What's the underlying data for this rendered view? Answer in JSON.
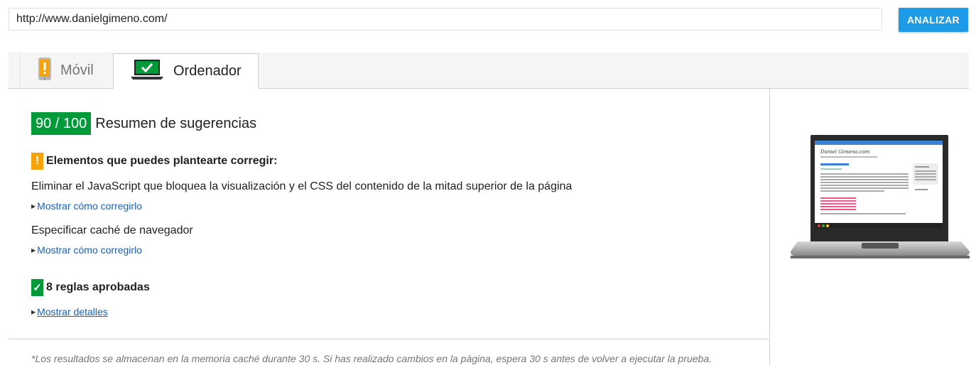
{
  "url_bar": {
    "value": "http://www.danielgimeno.com/"
  },
  "analyze_button": {
    "label": "ANALIZAR"
  },
  "tabs": [
    {
      "label": "Móvil",
      "active": false
    },
    {
      "label": "Ordenador",
      "active": true
    }
  ],
  "score": {
    "value": "90 / 100",
    "title": "Resumen de sugerencias",
    "color": "#009a3a"
  },
  "warnings": {
    "icon": "!",
    "title": "Elementos que puedes plantearte corregir:",
    "items": [
      {
        "text": "Eliminar el JavaScript que bloquea la visualización y el CSS del contenido de la mitad superior de la página",
        "link": "Mostrar cómo corregirlo"
      },
      {
        "text": "Especificar caché de navegador",
        "link": "Mostrar cómo corregirlo"
      }
    ]
  },
  "passed": {
    "icon": "✓",
    "title": "8 reglas aprobadas",
    "link": "Mostrar detalles"
  },
  "footnote": "*Los resultados se almacenan en la memoria caché durante 30 s. Si has realizado cambios en la página, espera 30 s antes de volver a ejecutar la prueba.",
  "preview": {
    "site_title": "Daniel Gimeno.com",
    "icon": "laptop-preview"
  },
  "colors": {
    "accent": "#1e9be6",
    "pass": "#009a3a",
    "warn": "#f4a40a",
    "link": "#1a5fb4"
  }
}
